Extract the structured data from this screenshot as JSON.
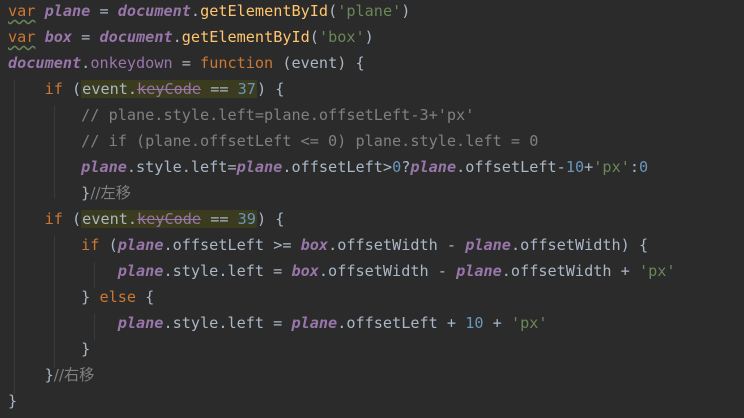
{
  "code": {
    "l1": {
      "kw": "var",
      "v": "plane",
      "eq": " = ",
      "o": "document",
      "dot": ".",
      "f": "getElementById",
      "p1": "(",
      "s": "'plane'",
      "p2": ")"
    },
    "l2": {
      "kw": "var",
      "v": "box",
      "eq": " = ",
      "o": "document",
      "dot": ".",
      "f": "getElementById",
      "p1": "(",
      "s": "'box'",
      "p2": ")"
    },
    "l3": {
      "o": "document",
      "dot": ".",
      "prop": "onkeydown",
      "eq": " = ",
      "kw": "function",
      "rest": " (event) {"
    },
    "l4": {
      "kw": "if",
      "p1": " (",
      "ev": "event.",
      "kc": "keyCode",
      "op": " == ",
      "num": "37",
      "p2": ") {"
    },
    "l5": {
      "cmt": "// plane.style.left=plane.offsetLeft-3+'px'"
    },
    "l6": {
      "cmt": "// if (plane.offsetLeft <= 0) plane.style.left = 0"
    },
    "l7": {
      "o": "plane",
      "a": ".style.left=",
      "o2": "plane",
      "b": ".offsetLeft>",
      "n1": "0",
      "c": "?",
      "o3": "plane",
      "d": ".offsetLeft-",
      "n2": "10",
      "e": "+",
      "s": "'px'",
      "f": ":",
      "n3": "0"
    },
    "l8": {
      "a": "}",
      "cmt": "//左移"
    },
    "l9": {
      "kw": "if",
      "p1": " (",
      "ev": "event.",
      "kc": "keyCode",
      "op": " == ",
      "num": "39",
      "p2": ") {"
    },
    "l10": {
      "kw": "if",
      "a": " (",
      "o": "plane",
      "b": ".offsetLeft >= ",
      "o2": "box",
      "c": ".offsetWidth - ",
      "o3": "plane",
      "d": ".offsetWidth) {"
    },
    "l11": {
      "o": "plane",
      "a": ".style.left = ",
      "o2": "box",
      "b": ".offsetWidth - ",
      "o3": "plane",
      "c": ".offsetWidth + ",
      "s": "'px'"
    },
    "l12": {
      "a": "} ",
      "kw": "else",
      "b": " {"
    },
    "l13": {
      "o": "plane",
      "a": ".style.left = ",
      "o2": "plane",
      "b": ".offsetLeft + ",
      "n": "10",
      "c": " + ",
      "s": "'px'"
    },
    "l14": {
      "a": "}"
    },
    "l15": {
      "a": "}",
      "cmt": "//右移"
    },
    "l16": {
      "a": "}"
    }
  },
  "colors": {
    "background": "#2b2b2b",
    "keyword": "#cc7832",
    "object": "#9876aa",
    "function": "#ffc66d",
    "string": "#6a8759",
    "number": "#6897bb",
    "comment": "#808080",
    "text": "#a9b7c6"
  }
}
